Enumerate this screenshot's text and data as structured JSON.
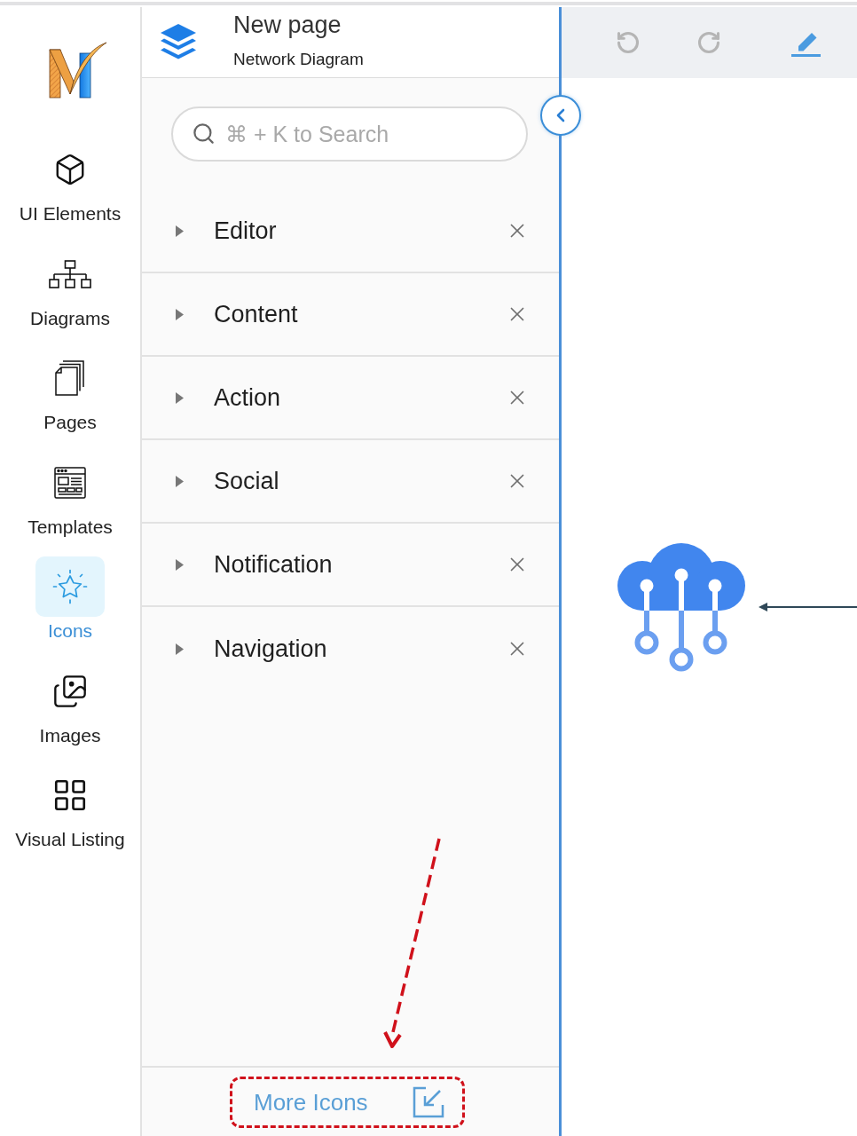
{
  "nav": [
    {
      "label": "UI Elements",
      "selected": false
    },
    {
      "label": "Diagrams",
      "selected": false
    },
    {
      "label": "Pages",
      "selected": false
    },
    {
      "label": "Templates",
      "selected": false
    },
    {
      "label": "Icons",
      "selected": true
    },
    {
      "label": "Images",
      "selected": false
    },
    {
      "label": "Visual Listing",
      "selected": false
    }
  ],
  "header": {
    "title": "New page",
    "subtitle": "Network Diagram"
  },
  "search": {
    "placeholder": "⌘ + K to Search"
  },
  "categories": [
    {
      "label": "Editor",
      "expanded": false
    },
    {
      "label": "Content",
      "expanded": false
    },
    {
      "label": "Action",
      "expanded": false
    },
    {
      "label": "Social",
      "expanded": false
    },
    {
      "label": "Notification",
      "expanded": false
    },
    {
      "label": "Navigation",
      "expanded": false
    }
  ],
  "more_icons": {
    "label": "More Icons"
  },
  "toolbar": [
    {
      "kind": "undo",
      "disabled": true
    },
    {
      "kind": "redo",
      "disabled": true
    },
    {
      "kind": "edit",
      "disabled": false
    }
  ]
}
